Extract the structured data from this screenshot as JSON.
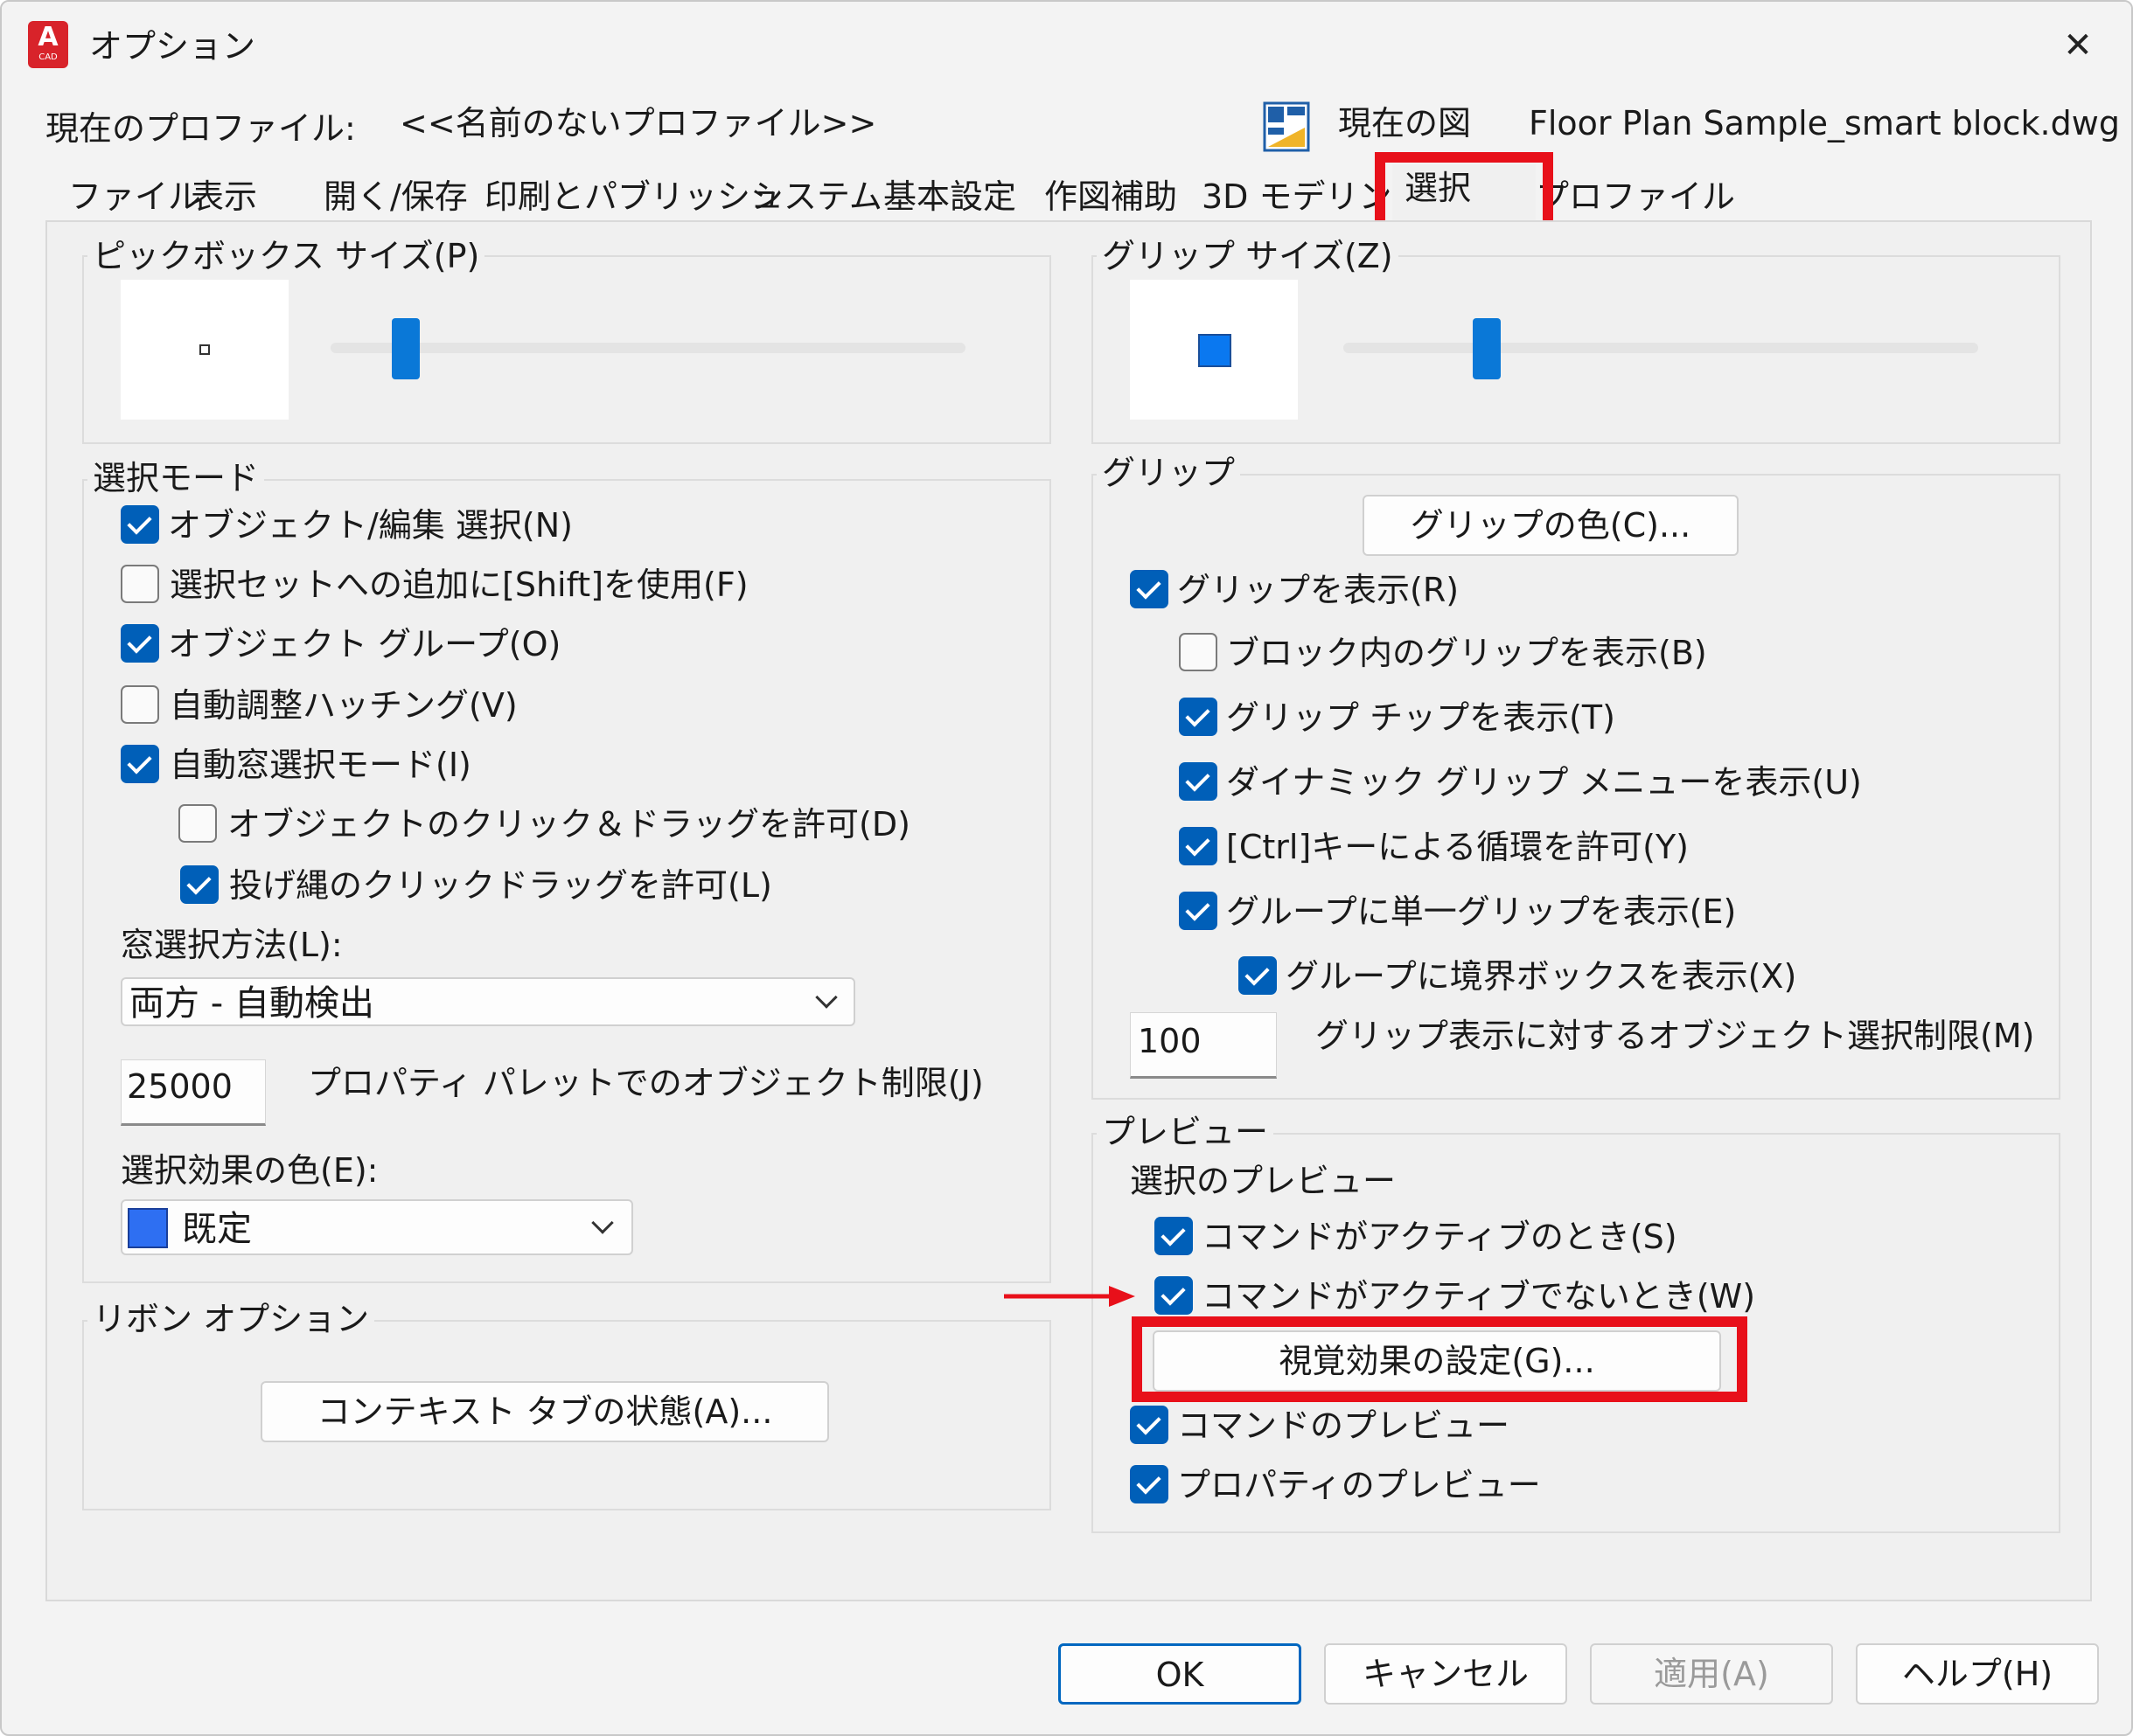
{
  "window": {
    "app_icon_letter": "A",
    "app_icon_sub": "CAD",
    "title": "オプション",
    "close_glyph": "✕",
    "accent_color": "#005fb8",
    "highlight_color": "#e8101a"
  },
  "profile": {
    "label": "現在のプロファイル:",
    "value": "<<名前のないプロファイル>>",
    "drawing_label": "現在の図",
    "drawing_value": "Floor Plan Sample_smart block.dwg"
  },
  "tabs": [
    {
      "label": "ファイル"
    },
    {
      "label": "表示"
    },
    {
      "label": "開く/保存"
    },
    {
      "label": "印刷とパブリッシュ"
    },
    {
      "label": "システム"
    },
    {
      "label": "基本設定"
    },
    {
      "label": "作図補助"
    },
    {
      "label": "3D モデリング"
    },
    {
      "label": "選択",
      "active": true
    },
    {
      "label": "プロファイル"
    }
  ],
  "pickbox": {
    "label": "ピックボックス サイズ(P)",
    "slider_fraction": 0.12
  },
  "grip_size": {
    "label": "グリップ サイズ(Z)",
    "slider_fraction": 0.22,
    "preview_color": "#0a78f0"
  },
  "selection_mode": {
    "label": "選択モード",
    "items": [
      {
        "label": "オブジェクト/編集 選択(N)",
        "checked": true
      },
      {
        "label": "選択セットへの追加に[Shift]を使用(F)",
        "checked": false
      },
      {
        "label": "オブジェクト グループ(O)",
        "checked": true
      },
      {
        "label": "自動調整ハッチング(V)",
        "checked": false
      },
      {
        "label": "自動窓選択モード(I)",
        "checked": true
      },
      {
        "label": "オブジェクトのクリック＆ドラッグを許可(D)",
        "checked": false
      },
      {
        "label": "投げ縄のクリックドラッグを許可(L)",
        "checked": true
      }
    ],
    "window_method_label": "窓選択方法(L):",
    "window_method_value": "両方 - 自動検出",
    "object_limit_value": "25000",
    "object_limit_label": "プロパティ パレットでのオブジェクト制限(J)",
    "effect_color_label": "選択効果の色(E):",
    "effect_color_value": "既定",
    "effect_color_swatch": "#2e6ff2"
  },
  "ribbon": {
    "label": "リボン オプション",
    "button": "コンテキスト タブの状態(A)..."
  },
  "grips": {
    "label": "グリップ",
    "color_button": "グリップの色(C)...",
    "items": [
      {
        "label": "グリップを表示(R)",
        "checked": true
      },
      {
        "label": "ブロック内のグリップを表示(B)",
        "checked": false
      },
      {
        "label": "グリップ チップを表示(T)",
        "checked": true
      },
      {
        "label": "ダイナミック グリップ メニューを表示(U)",
        "checked": true
      },
      {
        "label": "[Ctrl]キーによる循環を許可(Y)",
        "checked": true
      },
      {
        "label": "グループに単一グリップを表示(E)",
        "checked": true
      },
      {
        "label": "グループに境界ボックスを表示(X)",
        "checked": true
      }
    ],
    "limit_value": "100",
    "limit_label": "グリップ表示に対するオブジェクト選択制限(M)"
  },
  "preview": {
    "label": "プレビュー",
    "selection_preview_label": "選択のプレビュー",
    "items": [
      {
        "label": "コマンドがアクティブのとき(S)",
        "checked": true
      },
      {
        "label": "コマンドがアクティブでないとき(W)",
        "checked": true
      }
    ],
    "visual_effects_button": "視覚効果の設定(G)...",
    "items2": [
      {
        "label": "コマンドのプレビュー",
        "checked": true
      },
      {
        "label": "プロパティのプレビュー",
        "checked": true
      }
    ]
  },
  "footer": {
    "ok": "OK",
    "cancel": "キャンセル",
    "apply": "適用(A)",
    "help": "ヘルプ(H)"
  }
}
